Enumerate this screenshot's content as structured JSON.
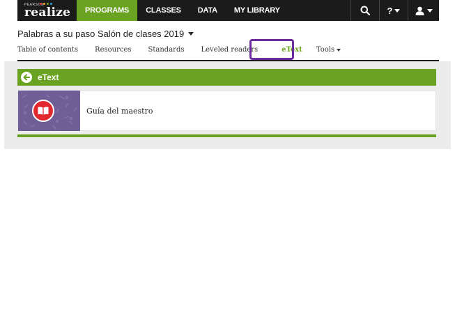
{
  "topbar": {
    "brand_small": "PEARSON",
    "brand": "realize",
    "dot_colors": [
      "#e2282f",
      "#f5a623",
      "#6aa321",
      "#2a9fd8"
    ],
    "nav": [
      {
        "label": "PROGRAMS",
        "active": true
      },
      {
        "label": "CLASSES",
        "active": false
      },
      {
        "label": "DATA",
        "active": false
      },
      {
        "label": "MY LIBRARY",
        "active": false
      }
    ],
    "icons": [
      "search-icon",
      "help-icon",
      "user-icon"
    ],
    "help_label": "?",
    "colors": {
      "bar": "#1b1b1b",
      "active": "#6aa321"
    }
  },
  "program": {
    "title": "Palabras a su paso Salón de clases 2019"
  },
  "tabs": [
    {
      "label": "Table of contents"
    },
    {
      "label": "Resources"
    },
    {
      "label": "Standards"
    },
    {
      "label": "Leveled readers"
    },
    {
      "label": "eText",
      "active": true
    },
    {
      "label": "Tools"
    }
  ],
  "highlight_color": "#6b2d9e",
  "etext_section": {
    "title": "eText",
    "items": [
      {
        "title": "Guía del maestro",
        "icon": "book-icon",
        "icon_color": "#e2282f",
        "thumb_color": "#6f5f96"
      }
    ]
  }
}
